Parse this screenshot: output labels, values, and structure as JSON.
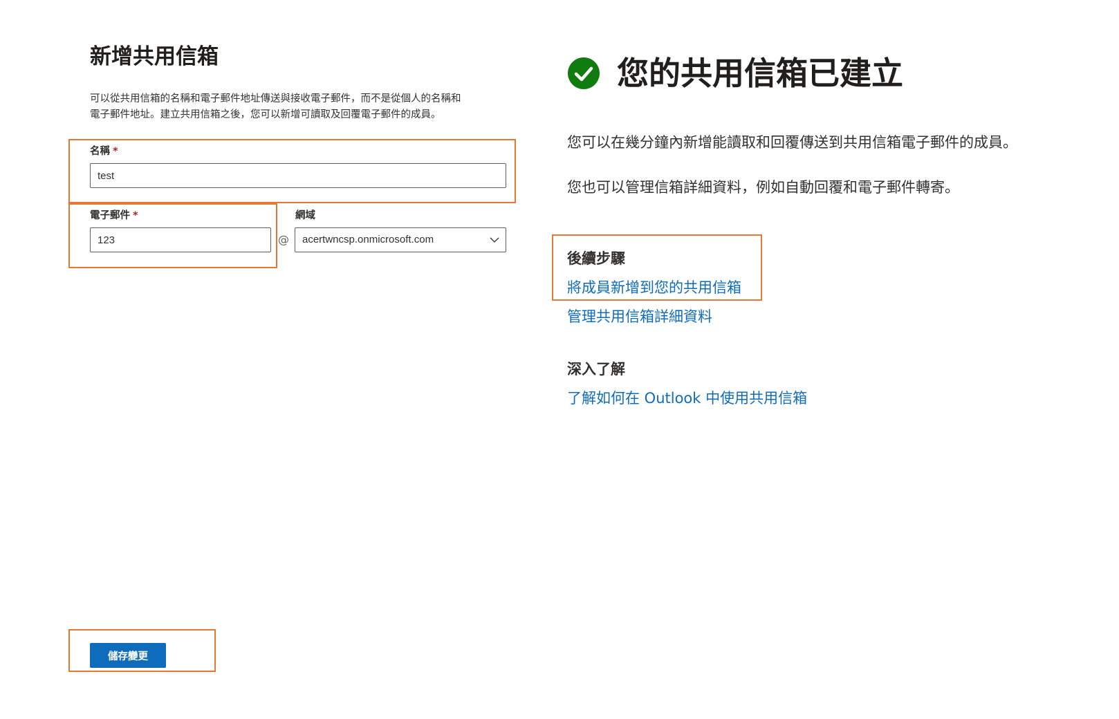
{
  "form": {
    "title": "新增共用信箱",
    "description_line1": "可以從共用信箱的名稱和電子郵件地址傳送與接收電子郵件，而不是從個人的名稱和",
    "description_line2": "電子郵件地址。建立共用信箱之後，您可以新增可讀取及回覆電子郵件的成員。",
    "name_label": "名稱",
    "name_value": "test",
    "email_label": "電子郵件",
    "email_value": "123",
    "required_mark": "*",
    "at_sign": "@",
    "domain_label": "網域",
    "domain_value": "acertwncsp.onmicrosoft.com",
    "save_label": "儲存變更"
  },
  "confirmation": {
    "title": "您的共用信箱已建立",
    "para1": "您可以在幾分鐘內新增能讀取和回覆傳送到共用信箱電子郵件的成員。",
    "para2": "您也可以管理信箱詳細資料，例如自動回覆和電子郵件轉寄。",
    "next_steps_heading": "後續步驟",
    "link_add_members": "將成員新增到您的共用信箱",
    "link_manage_details": "管理共用信箱詳細資料",
    "learn_more_heading": "深入了解",
    "link_learn_outlook": "了解如何在 Outlook 中使用共用信箱"
  },
  "icons": {
    "success": "check-circle-icon",
    "dropdown": "chevron-down-icon"
  },
  "colors": {
    "highlight": "#e87733",
    "link": "#0f6cbd",
    "primary_button": "#0f6cbd",
    "success": "#107c10",
    "required": "#a4262c"
  }
}
